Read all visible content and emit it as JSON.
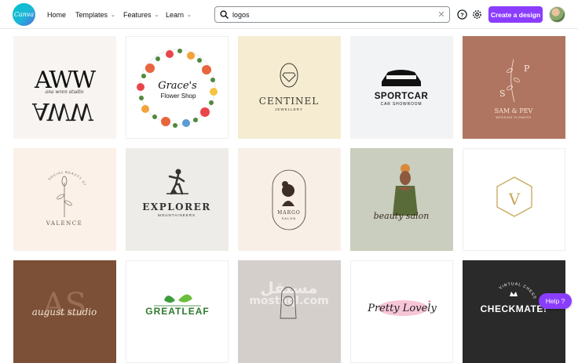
{
  "app": {
    "logo_text": "Canva"
  },
  "nav": {
    "home": "Home",
    "templates": "Templates",
    "features": "Features",
    "learn": "Learn"
  },
  "search": {
    "value": "logos",
    "placeholder": "Search"
  },
  "header": {
    "create_label": "Create a design",
    "help_label": "Help  ?"
  },
  "tiles": [
    {
      "label": "ana wren studio",
      "monogram": "AWW"
    },
    {
      "label": "Grace's",
      "sub": "Flower Shop"
    },
    {
      "label": "CENTINEL",
      "sub": "JEWELLERY"
    },
    {
      "label": "SPORTCAR",
      "sub": "CAR SHOWROOM"
    },
    {
      "label": "SAM & PEV",
      "sub": "WEDDING FLOWERS",
      "letters": [
        "P",
        "S"
      ]
    },
    {
      "label": "VALENCE",
      "sub": "SOCIAL BEAUTY STUDIO"
    },
    {
      "label": "EXPLORER",
      "sub": "MOUNTAINEERS"
    },
    {
      "label": "MARGO",
      "sub": "SALON"
    },
    {
      "label": "beauty salon"
    },
    {
      "label": "V"
    },
    {
      "label": "august studio",
      "monogram": "AS"
    },
    {
      "label": "GREATLEAF"
    },
    {
      "label": "mostaql.com",
      "overlay": "مستقل"
    },
    {
      "label": "Pretty Lovely"
    },
    {
      "label": "CHECKMATE!",
      "sub": "VIRTUAL CHESS"
    }
  ],
  "colors": {
    "brand": "#8b3dff",
    "logo": "#00c4cc"
  }
}
